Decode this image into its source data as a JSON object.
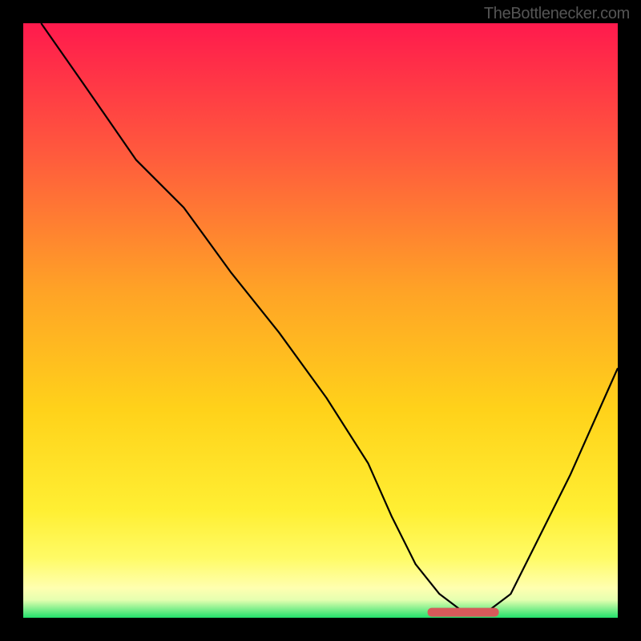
{
  "watermark": "TheBottlenecker.com",
  "chart_data": {
    "type": "line",
    "title": "",
    "xlabel": "",
    "ylabel": "",
    "xlim": [
      0,
      100
    ],
    "ylim": [
      0,
      100
    ],
    "grid": false,
    "background_gradient": {
      "top": "#ff1a4d",
      "mid_upper": "#ff6a3d",
      "mid": "#ffd21a",
      "mid_lower": "#ffff4d",
      "band": "#ffffa8",
      "bottom": "#22e06b"
    },
    "series": [
      {
        "name": "bottleneck-curve",
        "color": "#000000",
        "x": [
          3,
          10,
          19,
          27,
          35,
          43,
          51,
          58,
          62,
          66,
          70,
          74,
          78,
          82,
          86,
          92,
          100
        ],
        "y": [
          100,
          90,
          77,
          69,
          58,
          48,
          37,
          26,
          17,
          9,
          4,
          1,
          1,
          4,
          12,
          24,
          42
        ]
      }
    ],
    "marker": {
      "name": "optimal-band",
      "color": "#d65a5a",
      "x_start": 68,
      "x_end": 80,
      "y": 1
    }
  }
}
